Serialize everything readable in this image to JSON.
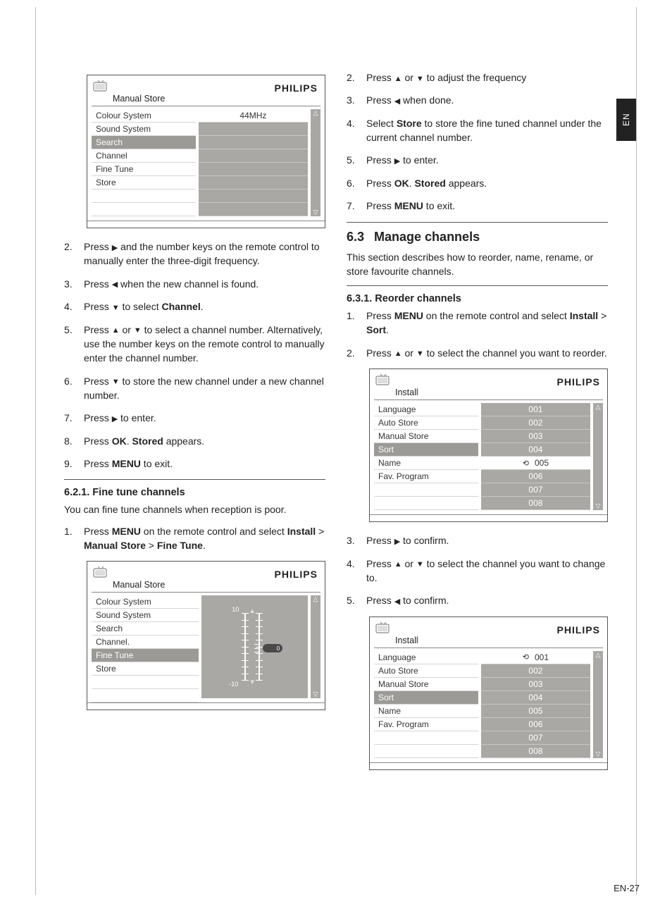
{
  "langTab": "EN",
  "pageNumber": "EN-27",
  "brand": "PHILIPS",
  "glyph": {
    "up": "▲",
    "down": "▼",
    "left": "◀",
    "right": "▶"
  },
  "leftCol": {
    "tv1": {
      "title": "Manual Store",
      "menu": [
        "Colour System",
        "Sound System",
        "Search",
        "Channel",
        "Fine Tune",
        "Store"
      ],
      "selectedIndex": 2,
      "valueTop": "44MHz"
    },
    "steps_a": [
      {
        "n": "2.",
        "pre": "Press ",
        "g": "right",
        "post": " and the number keys on the remote control to manually enter the three-digit frequency."
      },
      {
        "n": "3.",
        "pre": "Press ",
        "g": "left",
        "post": " when the new channel is found."
      },
      {
        "n": "4.",
        "pre": "Press ",
        "g": "down",
        "post": " to select ",
        "bold1": "Channel",
        "tail": "."
      },
      {
        "n": "5.",
        "pre": "Press ",
        "g": "up",
        "mid": " or ",
        "g2": "down",
        "post": " to select a channel number. Alternatively, use the number keys on the remote control to manually enter the channel number."
      },
      {
        "n": "6.",
        "pre": "Press ",
        "g": "down",
        "post": " to store the new channel under a new channel number."
      },
      {
        "n": "7.",
        "pre": "Press ",
        "g": "right",
        "post": " to enter."
      },
      {
        "n": "8.",
        "plain_pre": "Press ",
        "bold1": "OK",
        "plain_mid": ". ",
        "bold2": "Stored",
        "tail": " appears."
      },
      {
        "n": "9.",
        "plain_pre": "Press ",
        "bold1": "MENU",
        "tail": " to exit."
      }
    ],
    "sub621": "6.2.1.  Fine tune channels",
    "sub621_intro": "You can fine tune channels when reception is poor.",
    "step621_1": {
      "n": "1.",
      "pre": "Press ",
      "bold1": "MENU",
      "mid": " on the remote control and select ",
      "bold2": "Install",
      "sep1": " > ",
      "bold3": "Manual Store",
      "sep2": " > ",
      "bold4": "Fine Tune",
      "tail": "."
    },
    "tv2": {
      "title": "Manual Store",
      "menu": [
        "Colour System",
        "Sound System",
        "Search",
        "Channel.",
        "Fine Tune",
        "Store"
      ],
      "selectedIndex": 4,
      "sliderTop": "10",
      "sliderBot": "-10",
      "knob": "0"
    }
  },
  "rightCol": {
    "steps_top": [
      {
        "n": "2.",
        "pre": "Press ",
        "g": "up",
        "mid": " or ",
        "g2": "down",
        "post": " to adjust the frequency"
      },
      {
        "n": "3.",
        "pre": "Press ",
        "g": "left",
        "post": " when done."
      },
      {
        "n": "4.",
        "plain_pre": "Select ",
        "bold1": "Store",
        "tail": " to store the fine tuned channel under the current channel number."
      },
      {
        "n": "5.",
        "pre": "Press ",
        "g": "right",
        "post": " to enter."
      },
      {
        "n": "6.",
        "plain_pre": "Press ",
        "bold1": "OK",
        "plain_mid": ". ",
        "bold2": "Stored",
        "tail": " appears."
      },
      {
        "n": "7.",
        "plain_pre": "Press ",
        "bold1": "MENU",
        "tail": " to exit."
      }
    ],
    "sec63_num": "6.3",
    "sec63_title": "Manage channels",
    "sec63_intro": "This section describes how to reorder, name, rename, or store favourite channels.",
    "sub631": "6.3.1.  Reorder channels",
    "step631_1": {
      "n": "1.",
      "pre": "Press ",
      "bold1": "MENU",
      "mid": " on the remote control and select ",
      "bold2": "Install",
      "sep1": " > ",
      "bold3": "Sort",
      "tail": "."
    },
    "step631_2": {
      "n": "2.",
      "pre": "Press ",
      "g": "up",
      "mid": " or ",
      "g2": "down",
      "post": " to select the channel you want to reorder."
    },
    "tv3": {
      "title": "Install",
      "menu": [
        "Language",
        "Auto Store",
        "Manual Store",
        "Sort",
        "Name",
        "Fav. Program"
      ],
      "selectedIndex": 3,
      "values": [
        "001",
        "002",
        "003",
        "004",
        "005",
        "006",
        "007",
        "008"
      ],
      "lightIndex": 4,
      "lockIndex": 4
    },
    "steps_mid": [
      {
        "n": "3.",
        "pre": "Press ",
        "g": "right",
        "post": " to confirm."
      },
      {
        "n": "4.",
        "pre": "Press ",
        "g": "up",
        "mid": " or ",
        "g2": "down",
        "post": " to select the channel you want to change to."
      },
      {
        "n": "5.",
        "pre": "Press ",
        "g": "left",
        "post": " to confirm."
      }
    ],
    "tv4": {
      "title": "Install",
      "menu": [
        "Language",
        "Auto Store",
        "Manual Store",
        "Sort",
        "Name",
        "Fav. Program"
      ],
      "selectedIndex": 3,
      "values": [
        "001",
        "002",
        "003",
        "004",
        "005",
        "006",
        "007",
        "008"
      ],
      "lightIndex": 0,
      "lockIndex": 0
    }
  }
}
